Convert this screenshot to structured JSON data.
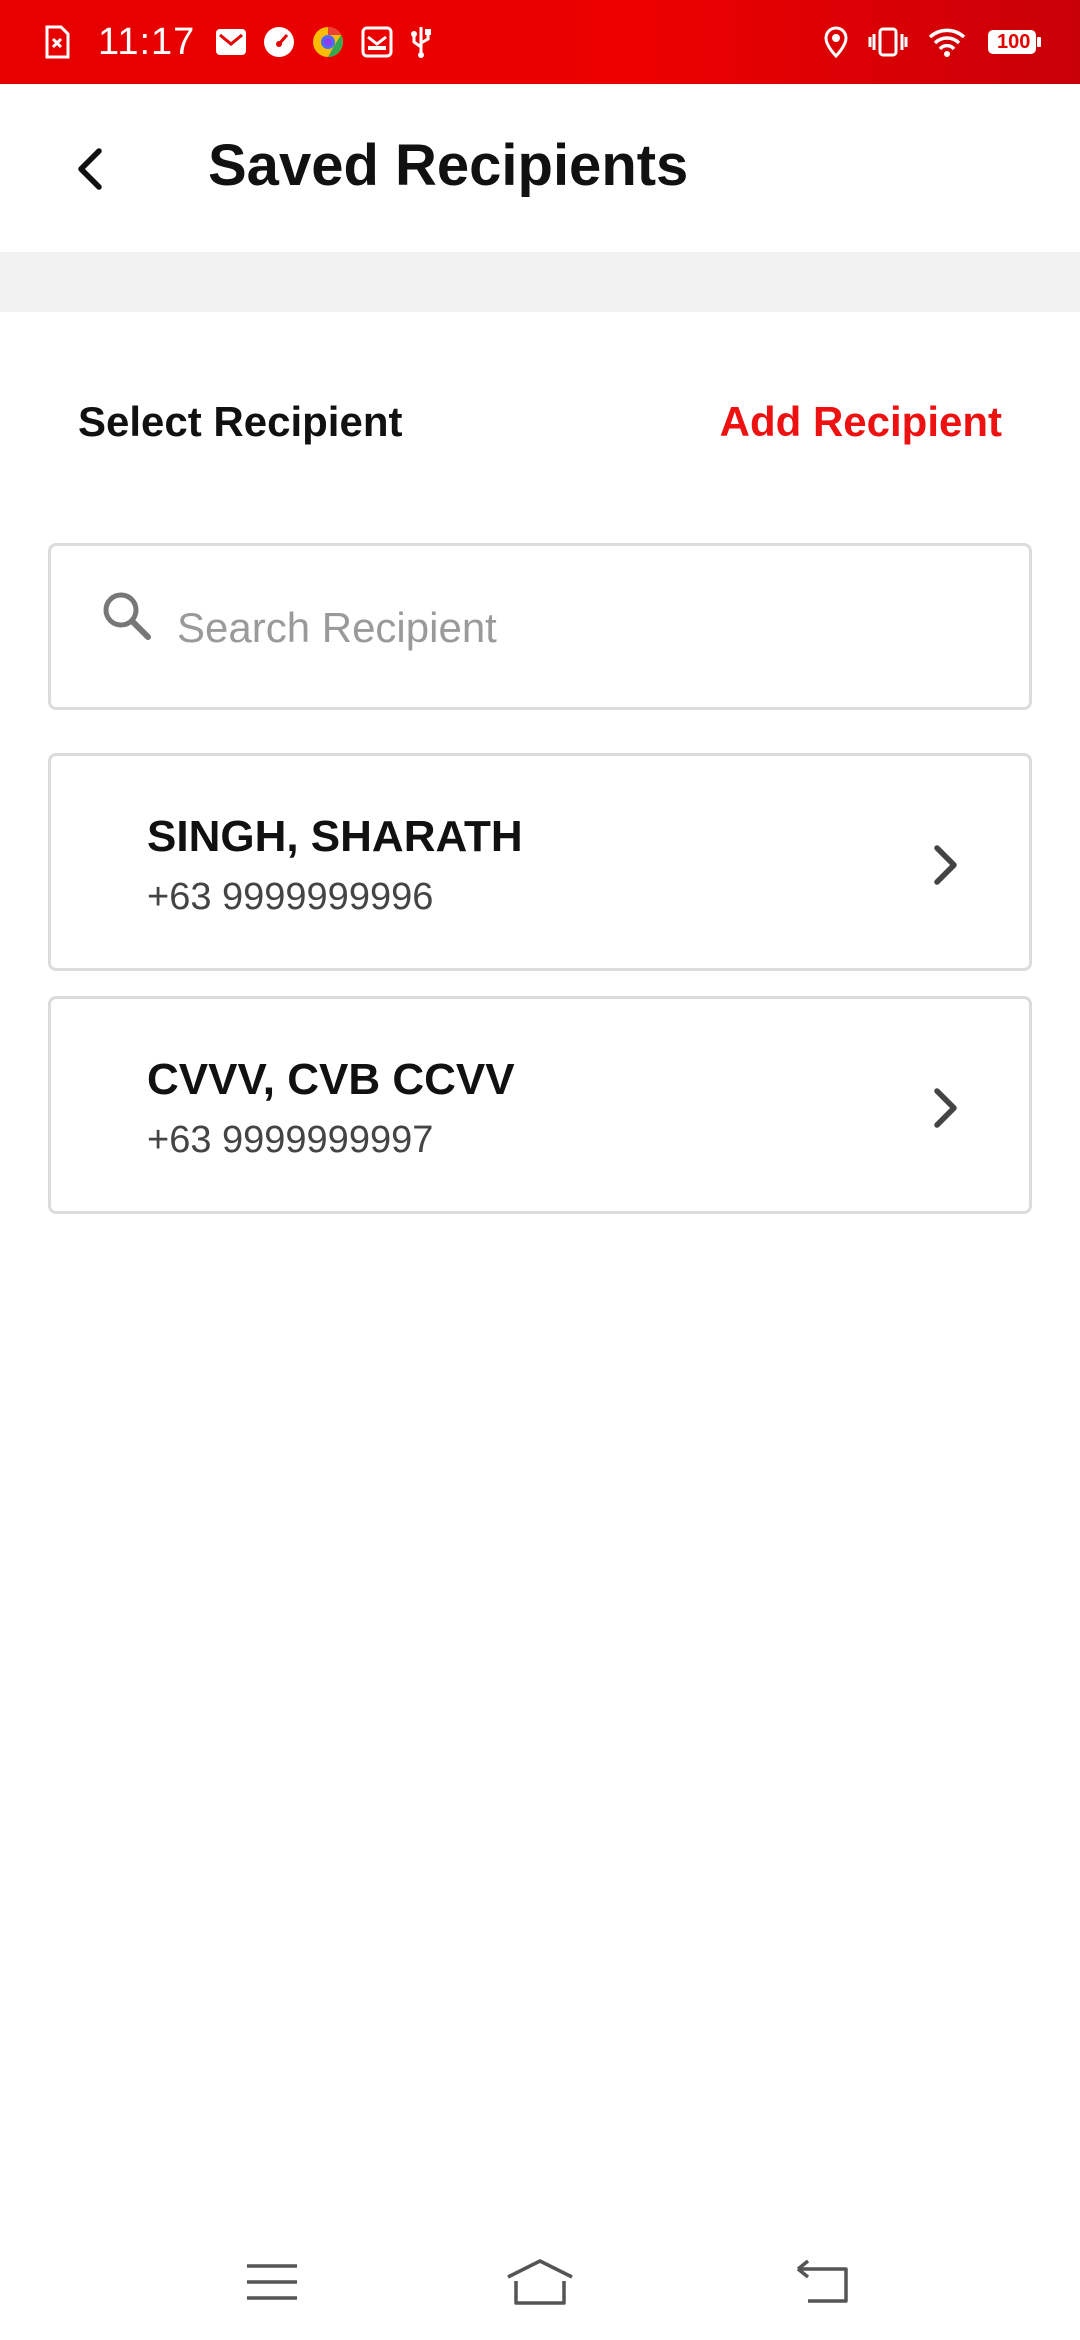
{
  "status_bar": {
    "time": "11:17",
    "battery_level": "100",
    "left_icons": [
      "sim-off-icon",
      "gmail-icon",
      "speedometer-icon",
      "browser-icon",
      "mail-icon",
      "usb-icon"
    ],
    "right_icons": [
      "location-icon",
      "vibrate-icon",
      "wifi-icon",
      "battery-icon"
    ]
  },
  "header": {
    "title": "Saved Recipients",
    "back_icon": "chevron-left-icon"
  },
  "section": {
    "label": "Select Recipient",
    "add_label": "Add Recipient"
  },
  "search": {
    "placeholder": "Search Recipient",
    "value": ""
  },
  "recipients": [
    {
      "name": "SINGH, SHARATH",
      "phone": "+63 9999999996"
    },
    {
      "name": "CVVV, CVB CCVV",
      "phone": "+63 9999999997"
    }
  ],
  "nav": {
    "icons": [
      "menu-icon",
      "home-icon",
      "back-icon"
    ]
  },
  "colors": {
    "status_bar": "#e60000",
    "accent": "#ee1111",
    "border": "#dcdcdc",
    "band": "#f2f2f2"
  }
}
